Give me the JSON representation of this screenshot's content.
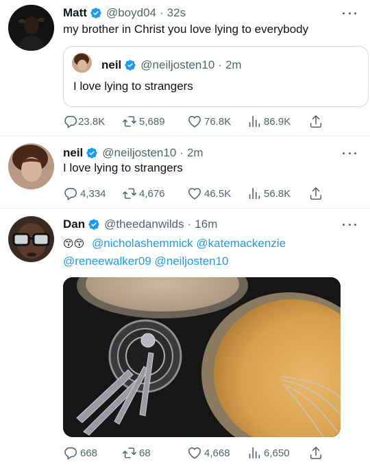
{
  "tweets": [
    {
      "name": "Matt",
      "handle": "@boyd04",
      "dot": "·",
      "time": "32s",
      "text": "my brother in Christ you love lying to everybody",
      "quote": {
        "name": "neil",
        "handle": "@neiljosten10",
        "dot": "·",
        "time": "2m",
        "text": "I love lying to strangers"
      },
      "replies": "23.8K",
      "retweets": "5,689",
      "likes": "76.8K",
      "views": "86.9K"
    },
    {
      "name": "neil",
      "handle": "@neiljosten10",
      "dot": "·",
      "time": "2m",
      "text": "I love lying to strangers",
      "replies": "4,334",
      "retweets": "4,676",
      "likes": "46.5K",
      "views": "56.8K"
    },
    {
      "name": "Dan",
      "handle": "@theedanwilds",
      "dot": "·",
      "time": "16m",
      "emoji": "😙😙",
      "mentions": [
        "@nicholashemmick",
        "@katemackenzie",
        "@reneewalker09",
        "@neiljosten10"
      ],
      "replies": "668",
      "retweets": "68",
      "likes": "4,668",
      "views": "6,650"
    }
  ],
  "icons": {
    "verified": "verified-badge-icon",
    "reply": "reply-icon",
    "retweet": "retweet-icon",
    "like": "heart-icon",
    "views": "views-icon",
    "share": "share-icon",
    "more": "more-icon"
  },
  "colors": {
    "accent": "#1d9bf0",
    "text": "#0f1419",
    "secondary": "#536471",
    "border": "#cfd9de"
  }
}
